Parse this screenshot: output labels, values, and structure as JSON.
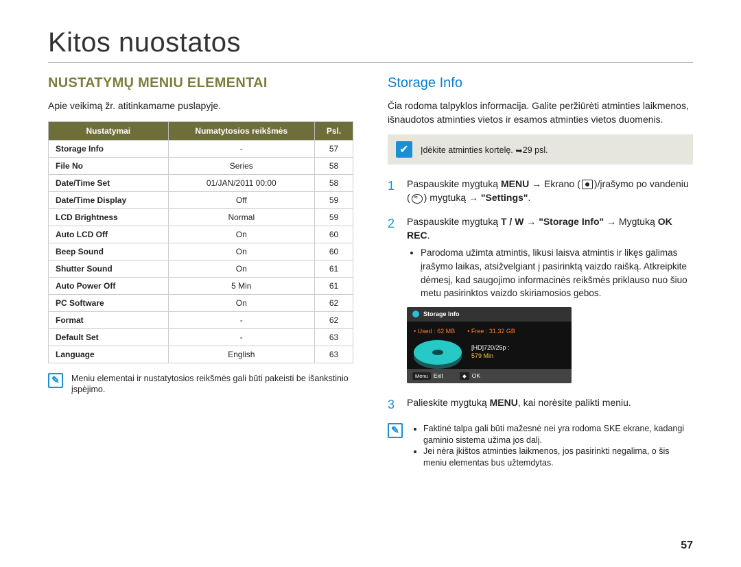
{
  "page": {
    "title": "Kitos nuostatos",
    "number": "57"
  },
  "left": {
    "heading": "Nustatymų meniu elementai",
    "intro": "Apie veikimą žr. atitinkamame puslapyje.",
    "table": {
      "headers": {
        "name": "Nustatymai",
        "value": "Numatytosios reikšmės",
        "page": "Psl."
      },
      "rows": [
        {
          "name": "Storage Info",
          "value": "-",
          "page": "57"
        },
        {
          "name": "File No",
          "value": "Series",
          "page": "58"
        },
        {
          "name": "Date/Time Set",
          "value": "01/JAN/2011 00:00",
          "page": "58"
        },
        {
          "name": "Date/Time Display",
          "value": "Off",
          "page": "59"
        },
        {
          "name": "LCD Brightness",
          "value": "Normal",
          "page": "59"
        },
        {
          "name": "Auto LCD Off",
          "value": "On",
          "page": "60"
        },
        {
          "name": "Beep Sound",
          "value": "On",
          "page": "60"
        },
        {
          "name": "Shutter Sound",
          "value": "On",
          "page": "61"
        },
        {
          "name": "Auto Power Off",
          "value": "5 Min",
          "page": "61"
        },
        {
          "name": "PC Software",
          "value": "On",
          "page": "62"
        },
        {
          "name": "Format",
          "value": "-",
          "page": "62"
        },
        {
          "name": "Default Set",
          "value": "-",
          "page": "63"
        },
        {
          "name": "Language",
          "value": "English",
          "page": "63"
        }
      ]
    },
    "note": "Meniu elementai ir nustatytosios reikšmės gali būti pakeisti be išankstinio įspėjimo."
  },
  "right": {
    "heading": "Storage Info",
    "intro": "Čia rodoma talpyklos informacija. Galite peržiūrėti atminties laikmenos, išnaudotos atminties vietos ir esamos atminties vietos duomenis.",
    "insertCard": "Įdėkite atminties kortelę.",
    "insertCardPage": "29 psl.",
    "steps": {
      "s1a": "Paspauskite mygtuką ",
      "s1b": "MENU",
      "s1c": " → Ekrano (",
      "s1d": ")/įrašymo po vandeniu (",
      "s1e": ") mygtuką → ",
      "s1f": "\"Settings\"",
      "s1g": ".",
      "s2a": "Paspauskite mygtuką ",
      "s2b": "T / W",
      "s2c": " → ",
      "s2d": "\"Storage Info\"",
      "s2e": " → Mygtuką ",
      "s2f": "OK REC",
      "s2g": ".",
      "s2bullet": "Parodoma užimta atmintis, likusi laisva atmintis ir likęs galimas įrašymo laikas, atsižvelgiant į pasirinktą vaizdo raišką. Atkreipkite dėmesį, kad saugojimo informacinės reikšmės priklauso nuo šiuo metu pasirinktos vaizdo skiriamosios gebos.",
      "s3a": "Palieskite mygtuką ",
      "s3b": "MENU",
      "s3c": ", kai norėsite palikti meniu."
    },
    "panel": {
      "title": "Storage Info",
      "usedLabel": "• Used : 62 MB",
      "freeLabel": "• Free : 31.32 GB",
      "resLine": "[HD]720/25p :",
      "minLine": "579 Min",
      "exit": "Exit",
      "ok": "OK",
      "menuBtn": "Menu"
    },
    "bottomNotes": {
      "n1": "Faktinė talpa gali būti mažesnė nei yra rodoma SKE ekrane, kadangi gaminio sistema užima jos dalį.",
      "n2": "Jei nėra įkištos atminties laikmenos, jos pasirinkti negalima, o šis meniu elementas bus užtemdytas."
    }
  }
}
